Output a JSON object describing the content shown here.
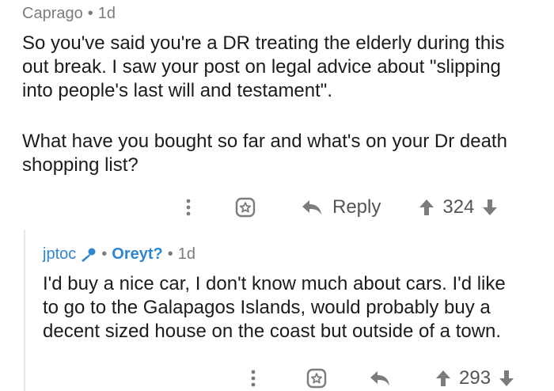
{
  "comment1": {
    "user": "Caprago",
    "age": "1d",
    "body": [
      "So you've said you're a DR treating the elderly during this",
      "out break. I saw your post on legal advice about \"slipping",
      "into people's last will and testament\".",
      "",
      "What have you bought so far and what's on your Dr death",
      "shopping list?"
    ],
    "reply_label": "Reply",
    "score": "324"
  },
  "comment2": {
    "user": "jptoc",
    "flair": "Oreyt?",
    "age": "1d",
    "body": [
      "I'd buy a nice car, I don't know much about cars. I'd like",
      "to go to the Galapagos Islands, would probably buy a",
      "decent sized house on the coast but outside of a town."
    ],
    "score": "293"
  },
  "colors": {
    "accent": "#2f86d1",
    "meta": "#7c7c7c"
  },
  "icons": [
    "more-icon",
    "award-icon",
    "reply-icon",
    "upvote-icon",
    "downvote-icon",
    "mic-icon"
  ]
}
